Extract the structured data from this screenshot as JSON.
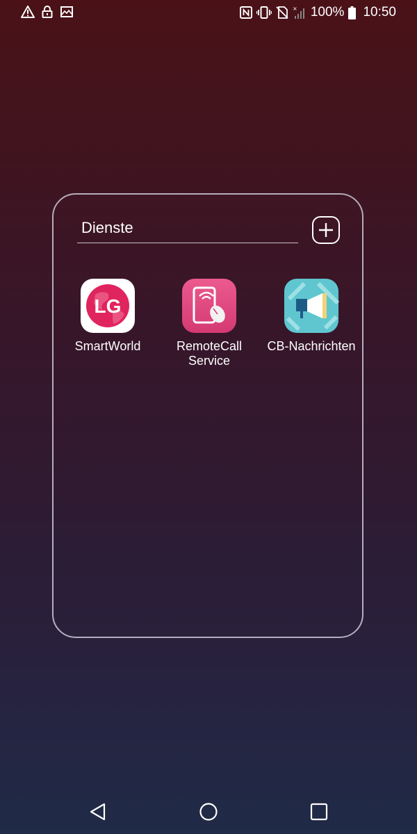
{
  "status_bar": {
    "left_icons": [
      "warning-icon",
      "lock-icon",
      "image-icon"
    ],
    "right_icons": [
      "nfc-icon",
      "vibrate-icon",
      "no-sim-icon",
      "signal-icon",
      "battery-icon"
    ],
    "battery_text": "100%",
    "time": "10:50"
  },
  "folder": {
    "title": "Dienste",
    "add_button": "plus-icon",
    "apps": [
      {
        "label": "SmartWorld",
        "icon": "lg-smartworld-icon",
        "color": "#e0245e"
      },
      {
        "label": "RemoteCall\nService",
        "icon": "remotecall-icon",
        "color": "#e2457e"
      },
      {
        "label": "CB-Nachrichten",
        "icon": "cell-broadcast-icon",
        "color": "#5fc6cf"
      }
    ]
  },
  "nav_bar": {
    "buttons": [
      "back-icon",
      "home-icon",
      "recents-icon"
    ]
  },
  "colors": {
    "background_top": "#4a1217",
    "background_bottom": "#1f2b47",
    "folder_border": "#cdc8d7"
  }
}
